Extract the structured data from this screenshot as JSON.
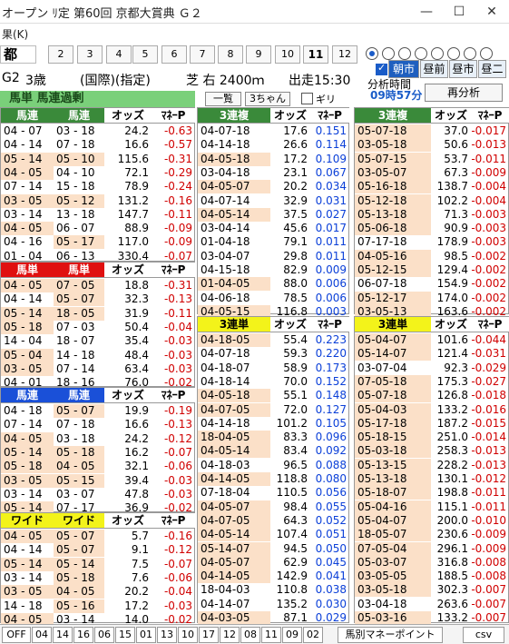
{
  "titlebar": {
    "title": "オープン  ﾘ定 第60回 京都大賞典   Ｇ２",
    "min": "—",
    "max": "☐",
    "close": "✕"
  },
  "menubar": {
    "label": "果(K)"
  },
  "place": "都",
  "races": [
    "2",
    "3",
    "4",
    "5",
    "6",
    "7",
    "8",
    "9",
    "10",
    "11",
    "12"
  ],
  "selected_race": "11",
  "options": {
    "tab_labels": [
      "朝市",
      "昼前",
      "昼市",
      "昼二"
    ],
    "tab_checked": "朝市"
  },
  "raceinfo": {
    "grade": "G2",
    "age": "3歳",
    "cond": "(国際)(指定)",
    "track": "芝 右 2400ｍ",
    "start": "出走15:30"
  },
  "bunseki": {
    "label": "分析時間",
    "time": "09時57分"
  },
  "reanalyze": "再分析",
  "greenbar": "馬単  馬連過剰",
  "mini": {
    "ichiran": "一覧",
    "chan": "3ちゃん",
    "giri": "ギリ"
  },
  "colors": {
    "green_header": "#2e7d2e",
    "red_header": "#e01010",
    "blue_header": "#1a50d8",
    "yellow_header": "#f3f31a"
  },
  "umaren": {
    "h1": "馬連",
    "h2": "馬連",
    "h3": "オッズ",
    "h4": "ﾏﾈｰP",
    "rows": [
      [
        "04 - 07",
        "03 - 18",
        "24.2",
        "-0.63"
      ],
      [
        "04 - 14",
        "07 - 18",
        "16.6",
        "-0.57"
      ],
      [
        "05 - 14",
        "05 - 10",
        "115.6",
        "-0.31"
      ],
      [
        "04 - 05",
        "04 - 10",
        "72.1",
        "-0.29"
      ],
      [
        "07 - 14",
        "15 - 18",
        "78.9",
        "-0.24"
      ],
      [
        "03 - 05",
        "05 - 12",
        "131.2",
        "-0.16"
      ],
      [
        "03 - 14",
        "13 - 18",
        "147.7",
        "-0.11"
      ],
      [
        "04 - 05",
        "06 - 07",
        "88.9",
        "-0.09"
      ],
      [
        "04 - 16",
        "05 - 17",
        "117.0",
        "-0.09"
      ],
      [
        "01 - 04",
        "06 - 13",
        "330.4",
        "-0.07"
      ]
    ]
  },
  "umatan": {
    "h1": "馬単",
    "h2": "馬単",
    "h3": "オッズ",
    "h4": "ﾏﾈｰP",
    "rows": [
      [
        "04 - 05",
        "07 - 05",
        "18.8",
        "-0.31"
      ],
      [
        "04 - 14",
        "05 - 07",
        "32.3",
        "-0.13"
      ],
      [
        "05 - 14",
        "18 - 05",
        "31.9",
        "-0.11"
      ],
      [
        "05 - 18",
        "07 - 03",
        "50.4",
        "-0.04"
      ],
      [
        "14 - 04",
        "18 - 07",
        "35.4",
        "-0.03"
      ],
      [
        "05 - 04",
        "14 - 18",
        "48.4",
        "-0.03"
      ],
      [
        "03 - 05",
        "07 - 14",
        "63.4",
        "-0.03"
      ],
      [
        "04 - 01",
        "18 - 16",
        "76.0",
        "-0.02"
      ]
    ]
  },
  "umaren2": {
    "h1": "馬連",
    "h2": "馬連",
    "h3": "オッズ",
    "h4": "ﾏﾈｰP",
    "rows": [
      [
        "04 - 18",
        "05 - 07",
        "19.9",
        "-0.19"
      ],
      [
        "07 - 14",
        "07 - 18",
        "16.6",
        "-0.13"
      ],
      [
        "04 - 05",
        "03 - 18",
        "24.2",
        "-0.12"
      ],
      [
        "05 - 14",
        "05 - 18",
        "16.2",
        "-0.07"
      ],
      [
        "05 - 18",
        "04 - 05",
        "32.1",
        "-0.06"
      ],
      [
        "03 - 05",
        "05 - 15",
        "39.4",
        "-0.03"
      ],
      [
        "03 - 14",
        "03 - 07",
        "47.8",
        "-0.03"
      ],
      [
        "05 - 14",
        "07 - 17",
        "36.9",
        "-0.02"
      ]
    ]
  },
  "wide": {
    "h1": "ワイド",
    "h2": "ワイド",
    "h3": "オッズ",
    "h4": "ﾏﾈｰP",
    "rows": [
      [
        "04 - 05",
        "05 - 07",
        "5.7",
        "-0.16"
      ],
      [
        "04 - 14",
        "05 - 07",
        "9.1",
        "-0.12"
      ],
      [
        "05 - 14",
        "05 - 14",
        "7.5",
        "-0.07"
      ],
      [
        "03 - 14",
        "05 - 18",
        "7.6",
        "-0.06"
      ],
      [
        "03 - 05",
        "04 - 05",
        "20.2",
        "-0.04"
      ],
      [
        "14 - 18",
        "05 - 16",
        "17.2",
        "-0.03"
      ],
      [
        "04 - 05",
        "03 - 14",
        "14.0",
        "-0.02"
      ]
    ]
  },
  "fuku3": {
    "h1": "3連複",
    "h2": "オッズ",
    "h3": "ﾏﾈｰP",
    "rows": [
      [
        "04-07-18",
        "17.6",
        "0.151"
      ],
      [
        "04-14-18",
        "26.6",
        "0.114"
      ],
      [
        "04-05-18",
        "17.2",
        "0.109"
      ],
      [
        "03-04-18",
        "23.1",
        "0.067"
      ],
      [
        "04-05-07",
        "20.2",
        "0.034"
      ],
      [
        "04-07-14",
        "32.9",
        "0.031"
      ],
      [
        "04-05-14",
        "37.5",
        "0.027"
      ],
      [
        "03-04-14",
        "45.6",
        "0.017"
      ],
      [
        "01-04-18",
        "79.1",
        "0.011"
      ],
      [
        "03-04-07",
        "29.8",
        "0.011"
      ],
      [
        "04-15-18",
        "82.9",
        "0.009"
      ],
      [
        "01-04-05",
        "88.0",
        "0.006"
      ],
      [
        "04-06-18",
        "78.5",
        "0.006"
      ],
      [
        "04-05-15",
        "116.8",
        "0.003"
      ]
    ]
  },
  "tan3": {
    "h1": "3連単",
    "h2": "オッズ",
    "h3": "ﾏﾈｰP",
    "rows": [
      [
        "04-18-05",
        "55.4",
        "0.223"
      ],
      [
        "04-07-18",
        "59.3",
        "0.220"
      ],
      [
        "04-18-07",
        "58.9",
        "0.173"
      ],
      [
        "04-18-14",
        "70.0",
        "0.152"
      ],
      [
        "04-05-18",
        "55.1",
        "0.148"
      ],
      [
        "04-07-05",
        "72.0",
        "0.127"
      ],
      [
        "04-14-18",
        "101.2",
        "0.105"
      ],
      [
        "18-04-05",
        "83.3",
        "0.096"
      ],
      [
        "04-05-14",
        "83.4",
        "0.092"
      ],
      [
        "04-18-03",
        "96.5",
        "0.088"
      ],
      [
        "04-14-05",
        "118.8",
        "0.080"
      ],
      [
        "07-18-04",
        "110.5",
        "0.056"
      ],
      [
        "04-05-07",
        "98.4",
        "0.055"
      ],
      [
        "04-07-05",
        "64.3",
        "0.052"
      ],
      [
        "04-05-14",
        "107.4",
        "0.051"
      ],
      [
        "05-14-07",
        "94.5",
        "0.050"
      ],
      [
        "04-05-07",
        "62.9",
        "0.045"
      ],
      [
        "04-14-05",
        "142.9",
        "0.041"
      ],
      [
        "18-04-03",
        "110.8",
        "0.038"
      ],
      [
        "04-14-07",
        "135.2",
        "0.030"
      ],
      [
        "04-03-05",
        "87.1",
        "0.029"
      ]
    ]
  },
  "fuku3b": {
    "h1": "3連複",
    "h2": "オッズ",
    "h3": "ﾏﾈｰP",
    "rows": [
      [
        "05-07-18",
        "37.0",
        "-0.017"
      ],
      [
        "03-05-18",
        "50.6",
        "-0.013"
      ],
      [
        "05-07-15",
        "53.7",
        "-0.011"
      ],
      [
        "03-05-07",
        "67.3",
        "-0.009"
      ],
      [
        "05-16-18",
        "138.7",
        "-0.004"
      ],
      [
        "05-12-18",
        "102.2",
        "-0.004"
      ],
      [
        "05-13-18",
        "71.3",
        "-0.003"
      ],
      [
        "05-06-18",
        "90.9",
        "-0.003"
      ],
      [
        "07-17-18",
        "178.9",
        "-0.003"
      ],
      [
        "04-05-16",
        "98.5",
        "-0.002"
      ],
      [
        "05-12-15",
        "129.4",
        "-0.002"
      ],
      [
        "06-07-18",
        "154.9",
        "-0.002"
      ],
      [
        "05-12-17",
        "174.0",
        "-0.002"
      ],
      [
        "03-05-13",
        "163.6",
        "-0.002"
      ]
    ]
  },
  "tan3b": {
    "h1": "3連単",
    "h2": "オッズ",
    "h3": "ﾏﾈｰP",
    "rows": [
      [
        "05-04-07",
        "101.6",
        "-0.044"
      ],
      [
        "05-14-07",
        "121.4",
        "-0.031"
      ],
      [
        "03-07-04",
        "92.3",
        "-0.029"
      ],
      [
        "07-05-18",
        "175.3",
        "-0.027"
      ],
      [
        "05-07-18",
        "126.8",
        "-0.018"
      ],
      [
        "05-04-03",
        "133.2",
        "-0.016"
      ],
      [
        "05-17-18",
        "187.2",
        "-0.015"
      ],
      [
        "05-18-15",
        "251.0",
        "-0.014"
      ],
      [
        "05-03-18",
        "258.3",
        "-0.013"
      ],
      [
        "05-13-15",
        "228.2",
        "-0.013"
      ],
      [
        "05-13-18",
        "130.1",
        "-0.012"
      ],
      [
        "05-18-07",
        "198.8",
        "-0.011"
      ],
      [
        "05-04-16",
        "115.1",
        "-0.011"
      ],
      [
        "05-04-07",
        "200.0",
        "-0.010"
      ],
      [
        "18-05-07",
        "230.6",
        "-0.009"
      ],
      [
        "07-05-04",
        "296.1",
        "-0.009"
      ],
      [
        "05-03-07",
        "316.8",
        "-0.008"
      ],
      [
        "03-05-05",
        "188.5",
        "-0.008"
      ],
      [
        "03-05-18",
        "302.3",
        "-0.007"
      ],
      [
        "03-04-18",
        "263.6",
        "-0.007"
      ],
      [
        "05-03-16",
        "133.2",
        "-0.007"
      ]
    ]
  },
  "bottom": {
    "items": [
      "OFF",
      "04",
      "14",
      "16",
      "06",
      "15",
      "01",
      "13",
      "10",
      "17",
      "12",
      "08",
      "11",
      "09",
      "02"
    ],
    "umabetsu": "馬別マネーポイント",
    "csv": "csv"
  }
}
